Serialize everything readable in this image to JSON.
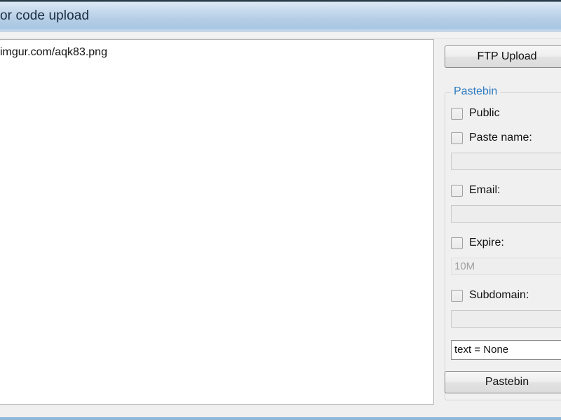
{
  "window": {
    "title": "or code upload"
  },
  "list": {
    "items": [
      {
        "text": "imgur.com/aqk83.png"
      }
    ]
  },
  "right_panel": {
    "ftp_upload_label": "FTP Upload",
    "group": {
      "legend": "Pastebin",
      "rows": [
        {
          "kind": "checkbox",
          "name": "public",
          "label": "Public",
          "checked": false
        },
        {
          "kind": "checkbox",
          "name": "paste-name",
          "label": "Paste name:",
          "checked": false
        },
        {
          "kind": "input",
          "name": "paste-name",
          "value": "",
          "placeholder": "",
          "state": "disabled"
        },
        {
          "kind": "checkbox",
          "name": "email",
          "label": "Email:",
          "checked": false
        },
        {
          "kind": "input",
          "name": "email",
          "value": "",
          "placeholder": "",
          "state": "disabled"
        },
        {
          "kind": "checkbox",
          "name": "expire",
          "label": "Expire:",
          "checked": false
        },
        {
          "kind": "input",
          "name": "expire",
          "value": "10M",
          "placeholder": "",
          "state": "disabled"
        },
        {
          "kind": "checkbox",
          "name": "subdomain",
          "label": "Subdomain:",
          "checked": false
        },
        {
          "kind": "input",
          "name": "subdomain",
          "value": "",
          "placeholder": "",
          "state": "disabled"
        },
        {
          "kind": "input",
          "name": "text-status",
          "value": "text = None",
          "placeholder": "",
          "state": "active"
        }
      ],
      "submit_label": "Pastebin"
    }
  },
  "colors": {
    "titlebar_start": "#dce9f5",
    "titlebar_end": "#a8c6e2",
    "group_legend": "#2f7cc0",
    "window_border": "#8fb8d8",
    "content_bg": "#ffffff",
    "panel_bg": "#f0f0f0"
  }
}
